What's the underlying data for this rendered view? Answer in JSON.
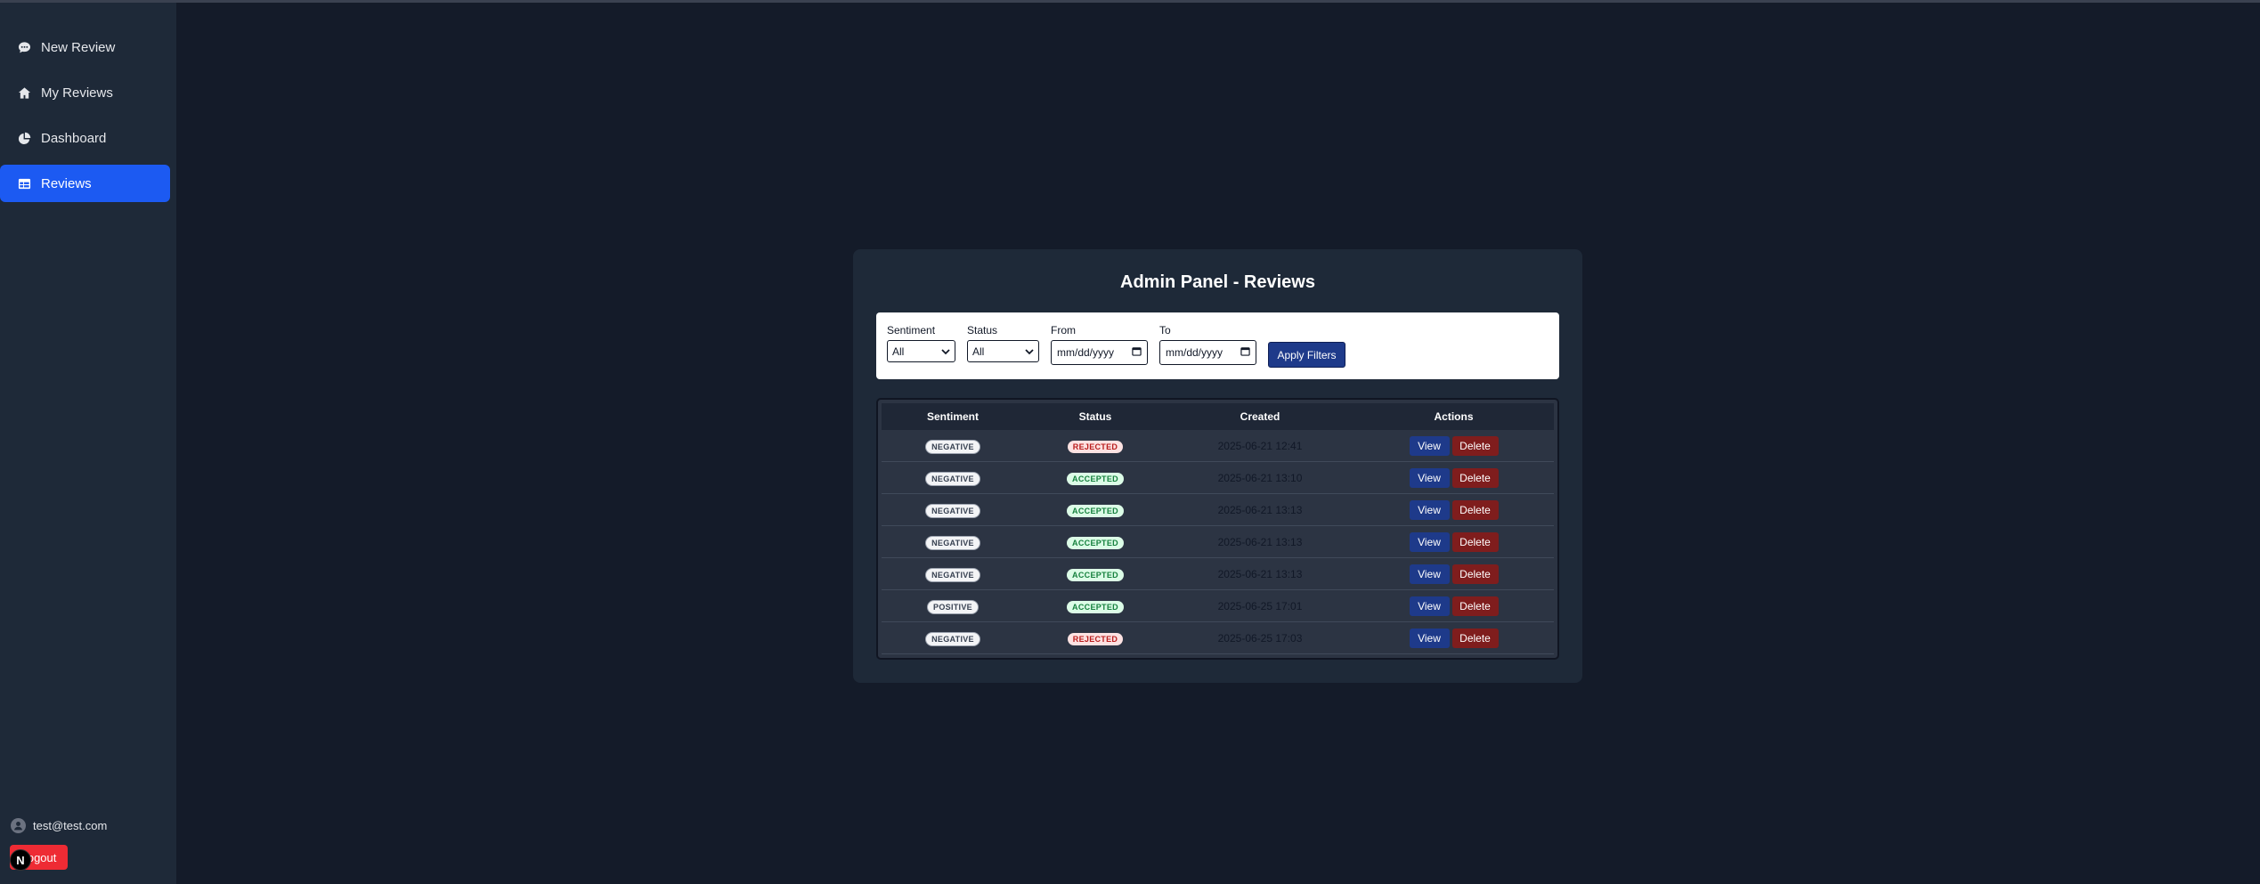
{
  "sidebar": {
    "items": [
      {
        "label": "New Review",
        "icon": "chat-icon"
      },
      {
        "label": "My Reviews",
        "icon": "home-icon"
      },
      {
        "label": "Dashboard",
        "icon": "pie-chart-icon"
      },
      {
        "label": "Reviews",
        "icon": "table-icon",
        "active": true
      }
    ],
    "user_email": "test@test.com",
    "logout_label": "Logout",
    "next_badge": "N"
  },
  "panel": {
    "title": "Admin Panel - Reviews",
    "filters": {
      "sentiment_label": "Sentiment",
      "sentiment_value": "All",
      "status_label": "Status",
      "status_value": "All",
      "from_label": "From",
      "from_placeholder": "mm/dd/yyyy",
      "to_label": "To",
      "to_placeholder": "mm/dd/yyyy",
      "apply_label": "Apply Filters"
    },
    "table": {
      "headers": {
        "sentiment": "Sentiment",
        "status": "Status",
        "created": "Created",
        "actions": "Actions"
      },
      "rows": [
        {
          "sentiment": "NEGATIVE",
          "status": "REJECTED",
          "created": "2025-06-21 12:41",
          "view": "View",
          "delete": "Delete"
        },
        {
          "sentiment": "NEGATIVE",
          "status": "ACCEPTED",
          "created": "2025-06-21 13:10",
          "view": "View",
          "delete": "Delete"
        },
        {
          "sentiment": "NEGATIVE",
          "status": "ACCEPTED",
          "created": "2025-06-21 13:13",
          "view": "View",
          "delete": "Delete"
        },
        {
          "sentiment": "NEGATIVE",
          "status": "ACCEPTED",
          "created": "2025-06-21 13:13",
          "view": "View",
          "delete": "Delete"
        },
        {
          "sentiment": "NEGATIVE",
          "status": "ACCEPTED",
          "created": "2025-06-21 13:13",
          "view": "View",
          "delete": "Delete"
        },
        {
          "sentiment": "POSITIVE",
          "status": "ACCEPTED",
          "created": "2025-06-25 17:01",
          "view": "View",
          "delete": "Delete"
        },
        {
          "sentiment": "NEGATIVE",
          "status": "REJECTED",
          "created": "2025-06-25 17:03",
          "view": "View",
          "delete": "Delete"
        }
      ]
    }
  },
  "colors": {
    "background": "#141b29",
    "sidebar": "#1e2938",
    "active_nav": "#1c5af2",
    "view_button": "#1e3a8a",
    "delete_button": "#7f1d1d",
    "logout": "#ee2b34"
  }
}
